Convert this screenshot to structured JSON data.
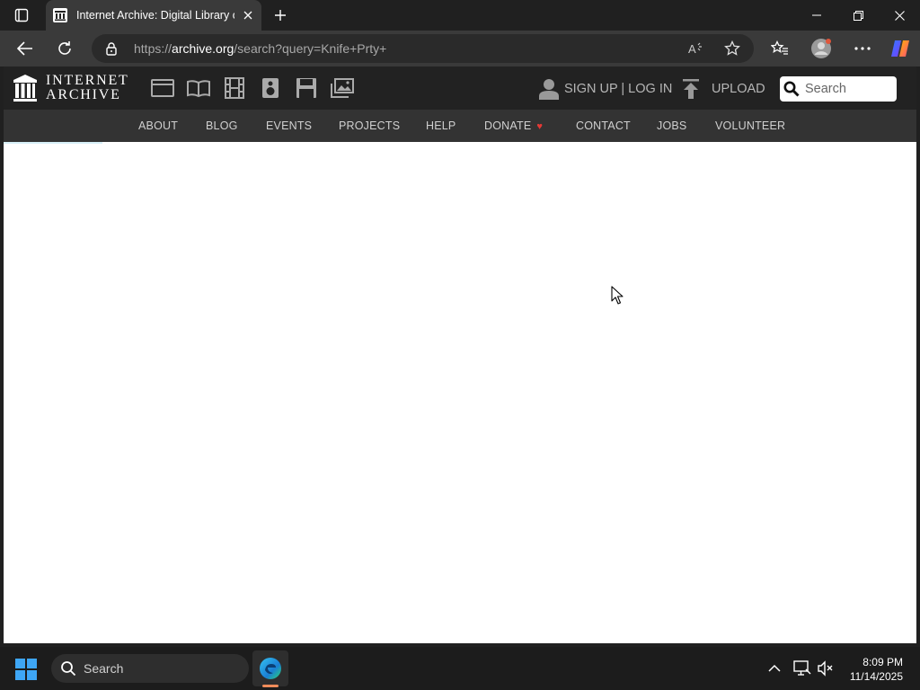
{
  "browser": {
    "tab_title": "Internet Archive: Digital Library of Free & Borrowable Books, Movies, Music & Wayback Machine",
    "url_prefix": "https://",
    "url_host": "archive.org",
    "url_path": "/search?query=Knife+Prty+"
  },
  "ia": {
    "logo_line1": "INTERNET",
    "logo_line2": "ARCHIVE",
    "account_label": "SIGN UP | LOG IN",
    "upload_label": "UPLOAD",
    "search_placeholder": "Search",
    "nav": [
      "ABOUT",
      "BLOG",
      "EVENTS",
      "PROJECTS",
      "HELP",
      "DONATE",
      "CONTACT",
      "JOBS",
      "VOLUNTEER"
    ],
    "donate_heart_color": "#e53935"
  },
  "taskbar": {
    "search_label": "Search",
    "time": "8:09 PM",
    "date": "11/14/2025"
  }
}
